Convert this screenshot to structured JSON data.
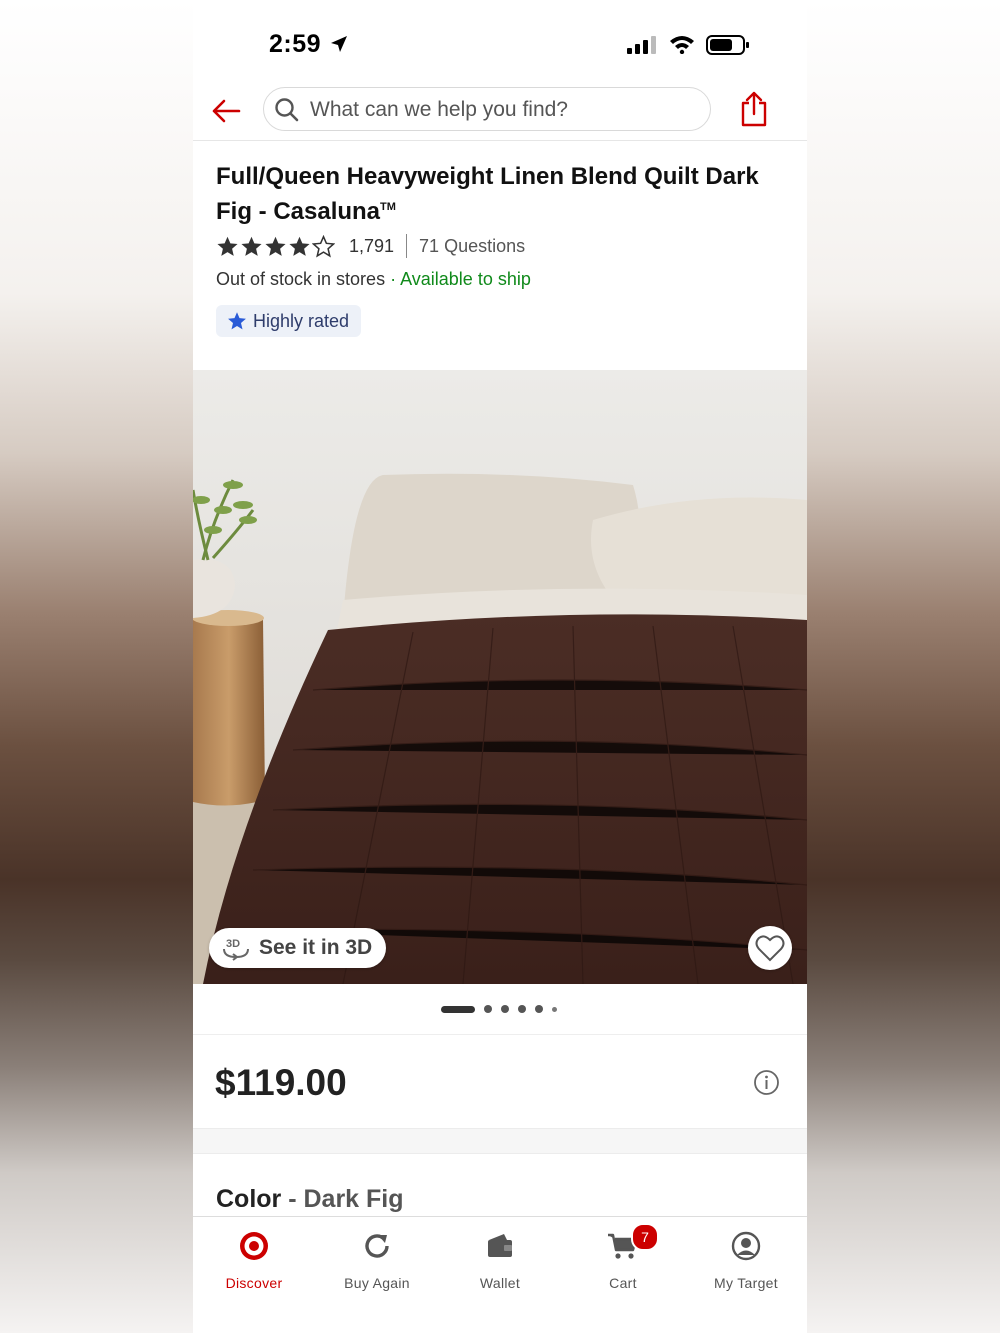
{
  "status_bar": {
    "time": "2:59"
  },
  "search": {
    "placeholder": "What can we help you find?"
  },
  "product": {
    "title": "Full/Queen Heavyweight Linen Blend Quilt Dark Fig - Casaluna",
    "trademark": "TM",
    "rating_stars": 4,
    "rating_max": 5,
    "rating_count": "1,791",
    "questions": "71 Questions",
    "stock_store": "Out of stock in stores",
    "stock_separator": " · ",
    "stock_ship": "Available to ship",
    "badge": "Highly rated",
    "see_3d": "See it in 3D",
    "price": "$119.00",
    "color_label": "Color",
    "color_separator": " - ",
    "color_value": "Dark Fig",
    "image_count": 6,
    "image_active": 1
  },
  "tabs": [
    {
      "label": "Discover",
      "icon": "target-bullseye-icon",
      "active": true
    },
    {
      "label": "Buy Again",
      "icon": "refresh-icon",
      "active": false
    },
    {
      "label": "Wallet",
      "icon": "wallet-icon",
      "active": false
    },
    {
      "label": "Cart",
      "icon": "cart-icon",
      "active": false,
      "badge": "7"
    },
    {
      "label": "My Target",
      "icon": "account-icon",
      "active": false
    }
  ],
  "colors": {
    "brand_red": "#cc0000",
    "available_green": "#108a1b",
    "badge_bg": "#edf1f8",
    "badge_star": "#2a5bd7"
  }
}
